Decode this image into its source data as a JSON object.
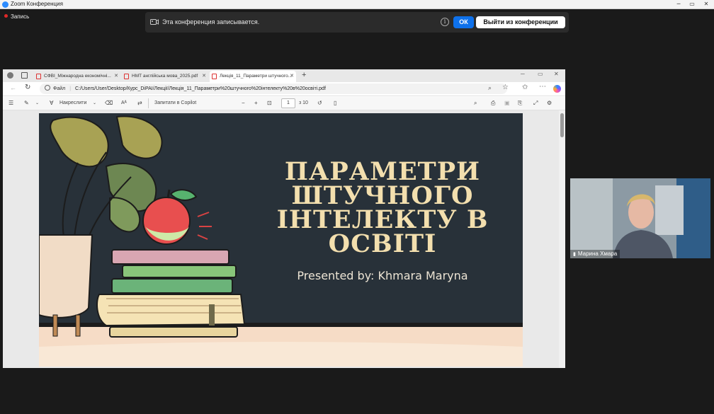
{
  "zoom": {
    "title": "Zoom Конференция",
    "recording_label": "Запись",
    "banner": {
      "message": "Эта конференция записывается.",
      "ok_label": "ОК",
      "leave_label": "Выйти из конференции"
    },
    "participant": {
      "name": "Марина Хмара"
    }
  },
  "browser": {
    "tabs": [
      {
        "label": "СФВІ_Міжнародна економічні..."
      },
      {
        "label": "НМТ англійська мова_2025.pdf"
      },
      {
        "label": "Лекція_11_Параметри штучного..."
      }
    ],
    "address": {
      "scheme_label": "Файл",
      "url": "C:/Users/User/Desktop/Курс_DiPAI/Лекції/Лекція_11_Параметри%20штучного%20інтелекту%20в%20освіті.pdf"
    },
    "pdf_toolbar": {
      "draw_label": "Накреслити",
      "copilot_label": "Запитати в Copilot",
      "page_current": "1",
      "page_total": "з 10"
    }
  },
  "slide": {
    "title_lines": [
      "ПАРАМЕТРИ",
      "ШТУЧНОГО",
      "ІНТЕЛЕКТУ В",
      "ОСВІТІ"
    ],
    "subtitle": "Presented by: Khmara Maryna"
  },
  "colors": {
    "slide_bg": "#283139",
    "title_color": "#f3dfae",
    "zoom_blue": "#0e71eb",
    "recording_red": "#e02828"
  }
}
